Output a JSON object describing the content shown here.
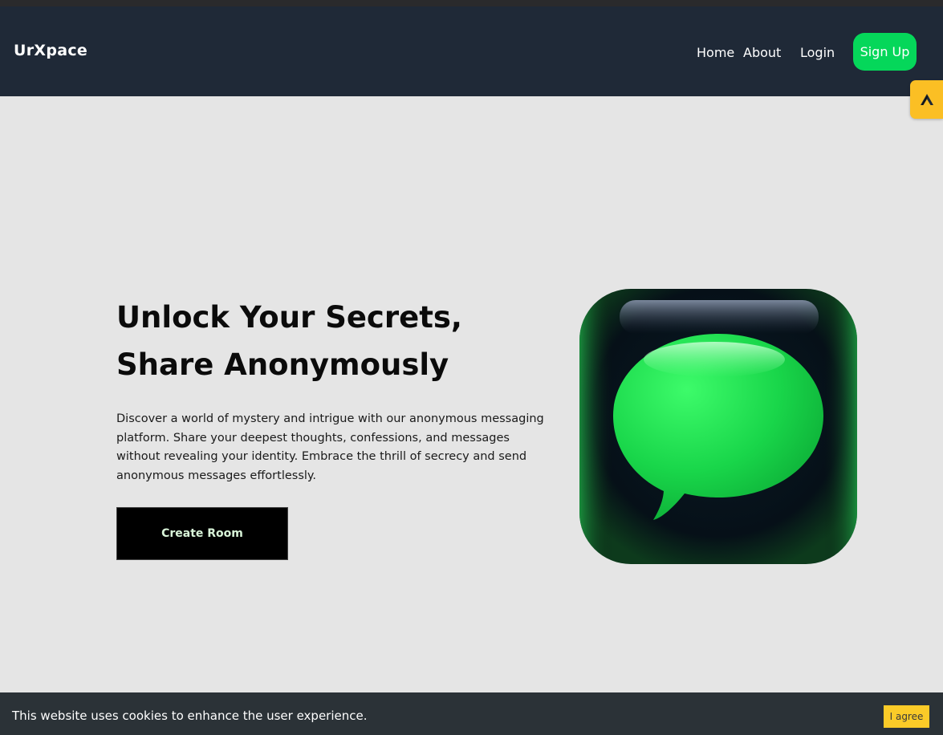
{
  "brand": {
    "logo_text": "UrXpace",
    "accent_color": "#05d75a"
  },
  "nav": {
    "items": [
      {
        "label": "Home"
      },
      {
        "label": "About"
      },
      {
        "label": "Login"
      }
    ],
    "signup_label": "Sign Up"
  },
  "side_tab": {
    "icon": "triangle-logo-icon",
    "color": "#fbbf24"
  },
  "hero": {
    "title": "Unlock Your Secrets, Share Anonymously",
    "description": "Discover a world of mystery and intrigue with our anonymous messaging platform. Share your deepest thoughts, confessions, and messages without revealing your identity. Embrace the thrill of secrecy and send anonymous messages effortlessly.",
    "cta_label": "Create Room",
    "image_icon": "chat-bubble-icon"
  },
  "cookie_banner": {
    "text": "This website uses cookies to enhance the user experience.",
    "agree_label": "I agree",
    "button_color": "#fbcb28"
  }
}
